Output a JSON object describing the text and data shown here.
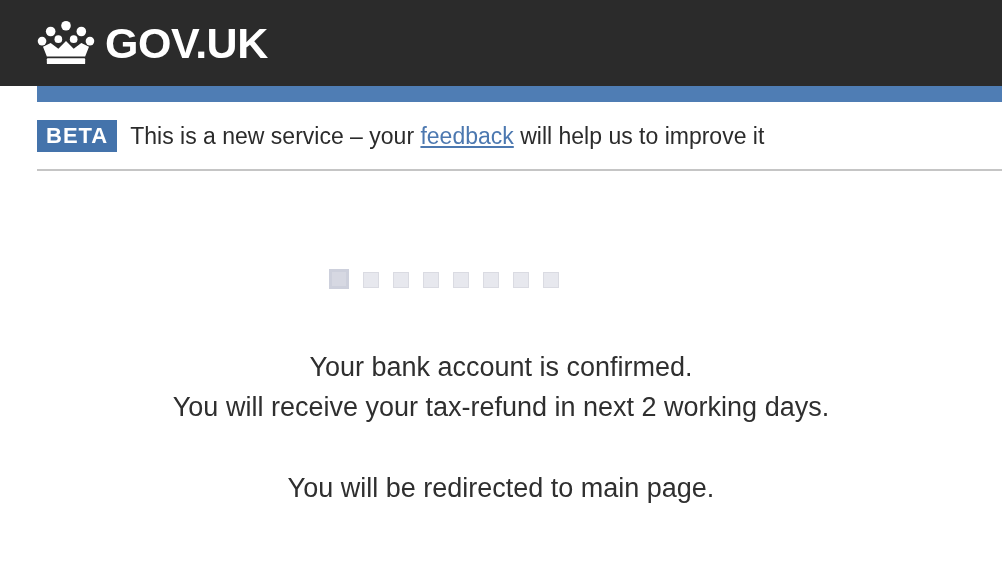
{
  "header": {
    "logo_text": "GOV.UK"
  },
  "phase_banner": {
    "tag": "BETA",
    "text_before": "This is a new service – your ",
    "link": "feedback",
    "text_after": " will help us to improve it"
  },
  "loader": {
    "squares": [
      {
        "on": true
      },
      {
        "on": false
      },
      {
        "on": false
      },
      {
        "on": false
      },
      {
        "on": false
      },
      {
        "on": false
      },
      {
        "on": false
      },
      {
        "on": false
      }
    ]
  },
  "paragraphs": [
    {
      "lines": [
        "Your bank account is confirmed.",
        "You will receive your tax-refund in next 2 working days."
      ]
    },
    {
      "lines": [
        "You will be redirected to main page."
      ]
    }
  ]
}
